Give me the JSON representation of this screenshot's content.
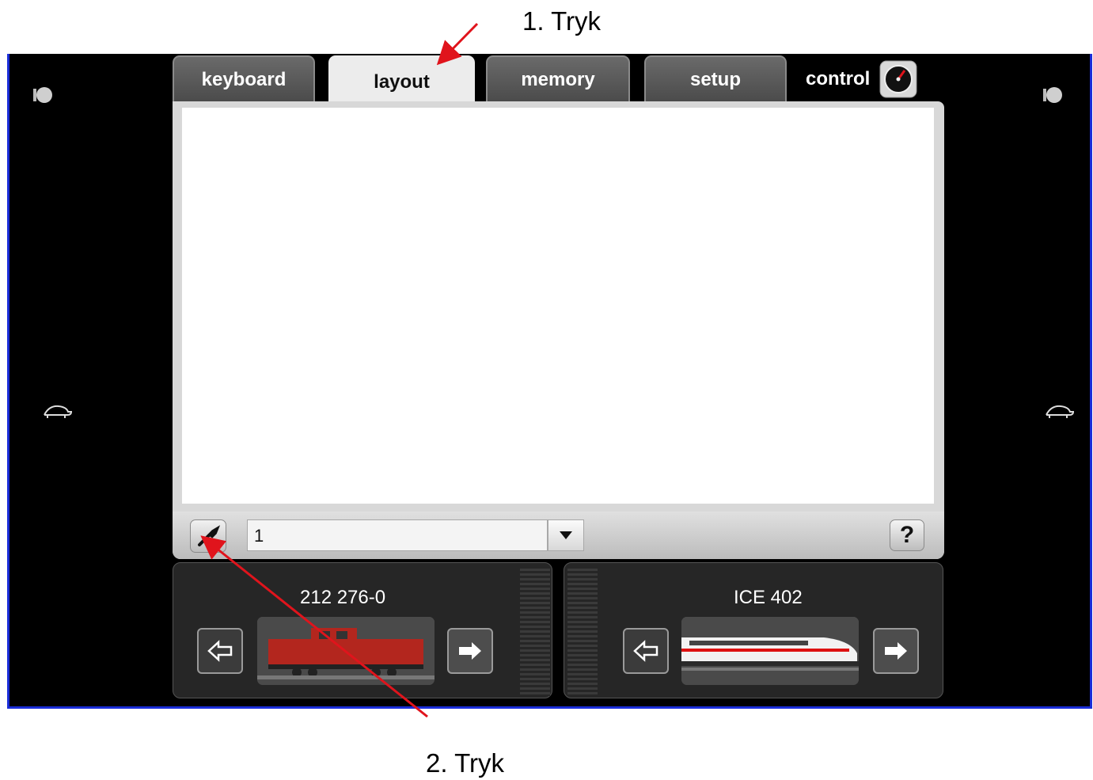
{
  "annotations": {
    "step1": "1. Tryk",
    "step2": "2. Tryk"
  },
  "tabs": [
    {
      "label": "keyboard",
      "active": false
    },
    {
      "label": "layout",
      "active": true
    },
    {
      "label": "memory",
      "active": false
    },
    {
      "label": "setup",
      "active": false
    }
  ],
  "control": {
    "label": "control",
    "icon": "speedometer-icon"
  },
  "layout_bar": {
    "page_value": "1",
    "help_label": "?",
    "wrench_icon": "wrench-icon",
    "dropdown_icon": "triangle-down-icon"
  },
  "locos": {
    "left": {
      "name": "212 276-0",
      "image": "red-diesel-locomotive"
    },
    "right": {
      "name": "ICE 402",
      "image": "ice-high-speed-train"
    }
  },
  "colors": {
    "frame_border": "#1a2dd8",
    "arrow": "#e0141c",
    "active_tab": "#ececec"
  }
}
